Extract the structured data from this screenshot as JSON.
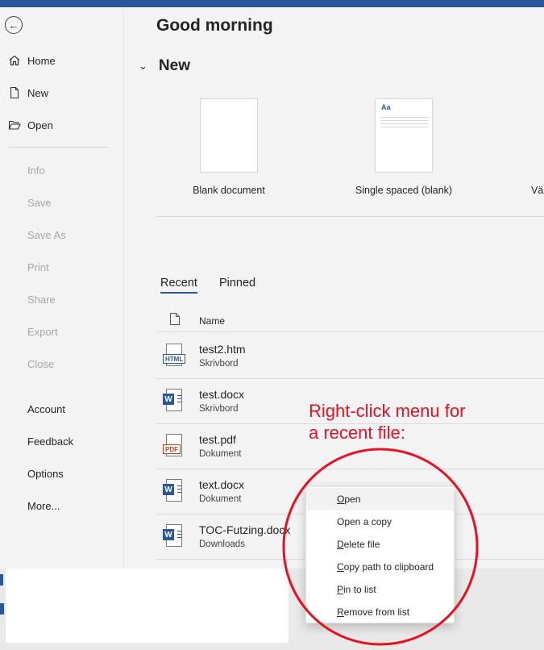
{
  "sidebar": {
    "top_items": [
      {
        "label": "Home",
        "icon": "home-icon"
      },
      {
        "label": "New",
        "icon": "new-document-icon"
      },
      {
        "label": "Open",
        "icon": "open-folder-icon"
      }
    ],
    "disabled_items": [
      "Info",
      "Save",
      "Save As",
      "Print",
      "Share",
      "Export",
      "Close"
    ],
    "bottom_items": [
      "Account",
      "Feedback",
      "Options",
      "More..."
    ]
  },
  "main": {
    "greeting": "Good morning",
    "new_section_title": "New",
    "templates": [
      {
        "label": "Blank document"
      },
      {
        "label": "Single spaced (blank)",
        "thumb_text": "Aa"
      },
      {
        "label": "Vä"
      }
    ],
    "tabs": [
      {
        "label": "Recent",
        "active": true
      },
      {
        "label": "Pinned",
        "active": false
      }
    ],
    "column_name": "Name",
    "files": [
      {
        "name": "test2.htm",
        "location": "Skrivbord",
        "type": "html",
        "badge": "HTML"
      },
      {
        "name": "test.docx",
        "location": "Skrivbord",
        "type": "word",
        "badge": "W"
      },
      {
        "name": "test.pdf",
        "location": "Dokument",
        "type": "pdf",
        "badge": "PDF"
      },
      {
        "name": "text.docx",
        "location": "Dokument",
        "type": "word",
        "badge": "W"
      },
      {
        "name": "TOC-Futzing.docx",
        "location": "Downloads",
        "type": "word",
        "badge": "W"
      }
    ]
  },
  "annotation": {
    "line1": "Right-click menu for",
    "line2": "a recent file:"
  },
  "context_menu": {
    "items": [
      {
        "label": "Open",
        "ul": "O",
        "rest": "pen",
        "hovered": true
      },
      {
        "label": "Open a copy",
        "ul": "",
        "rest": "Open a copy",
        "hovered": false
      },
      {
        "label": "Delete file",
        "ul": "D",
        "rest": "elete file",
        "hovered": false
      },
      {
        "label": "Copy path to clipboard",
        "ul": "C",
        "rest": "opy path to clipboard",
        "hovered": false
      },
      {
        "label": "Pin to list",
        "ul": "P",
        "rest": "in to list",
        "hovered": false
      },
      {
        "label": "Remove from list",
        "ul": "R",
        "rest": "emove from list",
        "hovered": false
      }
    ]
  },
  "colors": {
    "accent": "#2b579a",
    "annotation_red": "#e81123",
    "pdf_red": "#c43e1c"
  }
}
